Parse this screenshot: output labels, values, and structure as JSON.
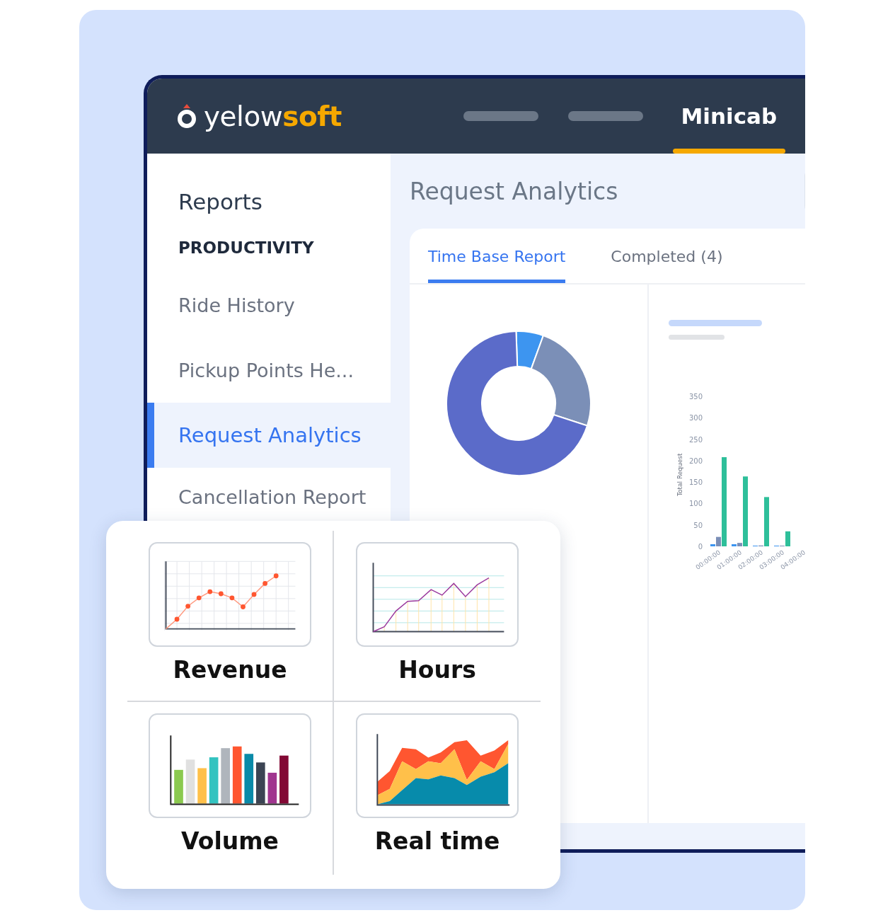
{
  "header": {
    "logo": {
      "name": "yelow",
      "accent": "soft"
    },
    "nav": [
      {
        "label": "Minicab",
        "selected": true
      }
    ]
  },
  "sidebar": {
    "title": "Reports",
    "section": "PRODUCTIVITY",
    "items": [
      {
        "label": "Ride History",
        "selected": false
      },
      {
        "label": "Pickup Points He...",
        "selected": false
      },
      {
        "label": "Request Analytics",
        "selected": true
      },
      {
        "label": "Cancellation Report",
        "selected": false
      }
    ]
  },
  "main": {
    "title": "Request Analytics",
    "tabs": [
      {
        "label": "Time Base Report",
        "selected": true
      },
      {
        "label": "Completed (4)",
        "selected": false
      }
    ],
    "chart_data": {
      "type": "bar",
      "ylabel": "Total Request",
      "categories": [
        "00:00:00",
        "01:00:00",
        "02:00:00",
        "03:00:00",
        "04:00:00"
      ],
      "ylim": [
        0,
        350
      ],
      "yticks": [
        0,
        50,
        100,
        150,
        200,
        250,
        300,
        350
      ],
      "series": [
        {
          "color": "#3d95f0",
          "values": [
            5,
            5,
            1,
            0,
            null
          ]
        },
        {
          "color": "#7b8fb7",
          "values": [
            22,
            8,
            2,
            0,
            null
          ]
        },
        {
          "color": "#2ebf9a",
          "values": [
            208,
            163,
            115,
            35,
            null
          ]
        }
      ]
    }
  },
  "features": [
    {
      "label": "Revenue",
      "kind": "scatter"
    },
    {
      "label": "Hours",
      "kind": "line"
    },
    {
      "label": "Volume",
      "kind": "bar"
    },
    {
      "label": "Real time",
      "kind": "area"
    }
  ]
}
